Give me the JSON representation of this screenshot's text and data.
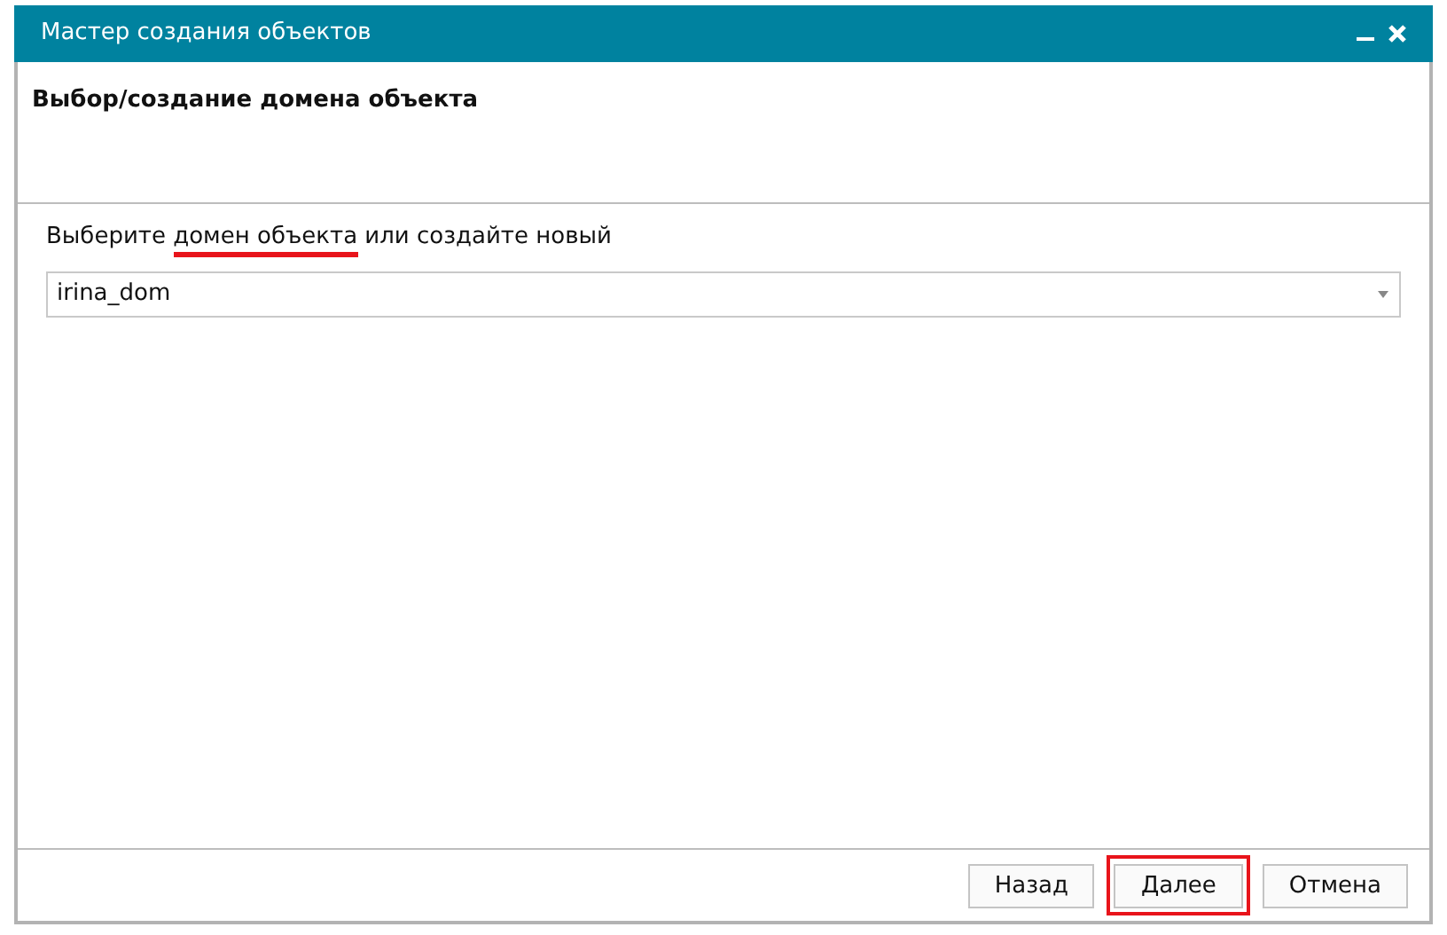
{
  "window": {
    "title": "Мастер создания объектов"
  },
  "header": {
    "title": "Выбор/создание домена объекта"
  },
  "prompt": {
    "before": "Выберите ",
    "highlighted": "домен объекта",
    "after": " или создайте новый"
  },
  "domain_select": {
    "value": "irina_dom"
  },
  "buttons": [
    {
      "label": "Назад",
      "highlighted": false
    },
    {
      "label": "Далее",
      "highlighted": true
    },
    {
      "label": "Отмена",
      "highlighted": false
    }
  ]
}
